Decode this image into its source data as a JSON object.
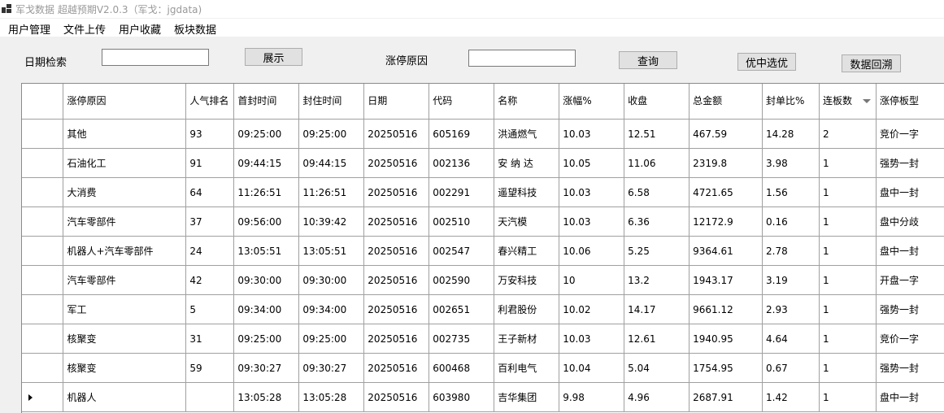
{
  "window": {
    "title": "军戈数据 超越预期V2.0.3（军戈：jgdata)"
  },
  "menu": [
    "用户管理",
    "文件上传",
    "用户收藏",
    "板块数据"
  ],
  "search": {
    "date_label": "日期检索",
    "date_value": "",
    "show_button": "展示",
    "reason_label": "涨停原因",
    "reason_value": "",
    "query_button": "查询",
    "pick_best_button": "优中选优",
    "backtest_button": "数据回溯"
  },
  "table": {
    "columns": [
      "涨停原因",
      "人气排名",
      "首封时间",
      "封住时间",
      "日期",
      "代码",
      "名称",
      "涨幅%",
      "收盘",
      "总金额",
      "封单比%",
      "连板数",
      "涨停板型"
    ],
    "rows": [
      [
        "其他",
        "93",
        "09:25:00",
        "09:25:00",
        "20250516",
        "605169",
        "洪通燃气",
        "10.03",
        "12.51",
        "467.59",
        "14.28",
        "2",
        "竞价一字"
      ],
      [
        "石油化工",
        "91",
        "09:44:15",
        "09:44:15",
        "20250516",
        "002136",
        "安 纳 达",
        "10.05",
        "11.06",
        "2319.8",
        "3.98",
        "1",
        "强势一封"
      ],
      [
        "大消费",
        "64",
        "11:26:51",
        "11:26:51",
        "20250516",
        "002291",
        "遥望科技",
        "10.03",
        "6.58",
        "4721.65",
        "1.56",
        "1",
        "盘中一封"
      ],
      [
        "汽车零部件",
        "37",
        "09:56:00",
        "10:39:42",
        "20250516",
        "002510",
        "天汽模",
        "10.03",
        "6.36",
        "12172.9",
        "0.16",
        "1",
        "盘中分歧"
      ],
      [
        "机器人+汽车零部件",
        "24",
        "13:05:51",
        "13:05:51",
        "20250516",
        "002547",
        "春兴精工",
        "10.06",
        "5.25",
        "9364.61",
        "2.78",
        "1",
        "盘中一封"
      ],
      [
        "汽车零部件",
        "42",
        "09:30:00",
        "09:30:00",
        "20250516",
        "002590",
        "万安科技",
        "10",
        "13.2",
        "1943.17",
        "3.19",
        "1",
        "开盘一字"
      ],
      [
        "军工",
        "5",
        "09:34:00",
        "09:34:00",
        "20250516",
        "002651",
        "利君股份",
        "10.02",
        "14.17",
        "9661.12",
        "2.93",
        "1",
        "强势一封"
      ],
      [
        "核聚变",
        "31",
        "09:25:00",
        "09:25:00",
        "20250516",
        "002735",
        "王子新材",
        "10.03",
        "12.61",
        "1940.95",
        "4.64",
        "1",
        "竞价一字"
      ],
      [
        "核聚变",
        "59",
        "09:30:27",
        "09:30:27",
        "20250516",
        "600468",
        "百利电气",
        "10.04",
        "5.04",
        "1754.95",
        "0.67",
        "1",
        "强势一封"
      ],
      [
        "机器人",
        "",
        "13:05:28",
        "13:05:28",
        "20250516",
        "603980",
        "吉华集团",
        "9.98",
        "4.96",
        "2687.91",
        "1.42",
        "1",
        "盘中一封"
      ]
    ],
    "current_row_index": 9
  }
}
